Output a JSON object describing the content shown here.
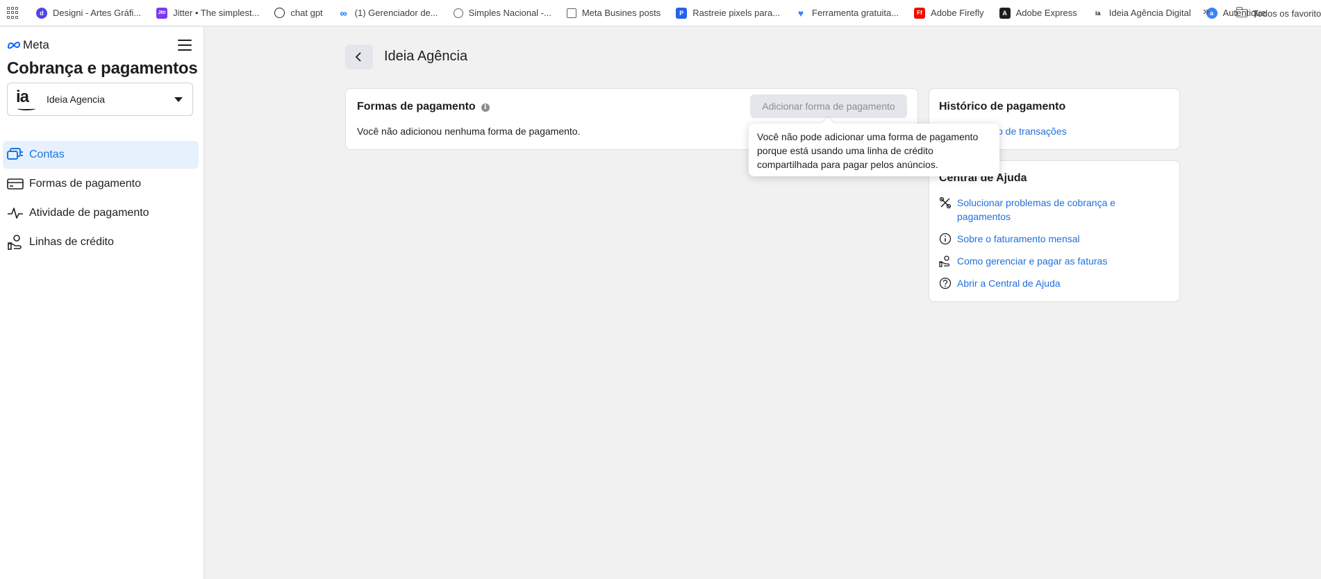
{
  "bookmarks": {
    "items": [
      {
        "label": "Designi - Artes Gráfi...",
        "icon": "designi-icon",
        "color": "#4f46e5"
      },
      {
        "label": "Jitter • The simplest...",
        "icon": "jitter-icon",
        "color": "#7c3aed"
      },
      {
        "label": "chat gpt",
        "icon": "openai-icon",
        "color": "#1c1e21"
      },
      {
        "label": "(1) Gerenciador de...",
        "icon": "meta-icon",
        "color": "#0866ff"
      },
      {
        "label": "Simples Nacional -...",
        "icon": "globe-icon",
        "color": "#5f6368"
      },
      {
        "label": "Meta Busines posts",
        "icon": "page-icon",
        "color": "#5f6368"
      },
      {
        "label": "Rastreie pixels para...",
        "icon": "pixel-icon",
        "color": "#2563eb"
      },
      {
        "label": "Ferramenta gratuita...",
        "icon": "heart-icon",
        "color": "#3b82f6"
      },
      {
        "label": "Adobe Firefly",
        "icon": "firefly-icon",
        "color": "#eb1000"
      },
      {
        "label": "Adobe Express",
        "icon": "adobe-express-icon",
        "color": "#1c1e21"
      },
      {
        "label": "Ideia Agência Digital",
        "icon": "ideia-icon",
        "color": "#5f6368"
      },
      {
        "label": "Autentique",
        "icon": "autentique-icon",
        "color": "#3b82f6"
      }
    ],
    "more": "»",
    "folder_label": "Todos os favoritos"
  },
  "sidebar": {
    "brand": "Meta",
    "title": "Cobrança e pagamentos",
    "account": {
      "logo_text": "ia",
      "name": "Ideia Agencia"
    },
    "nav": [
      {
        "label": "Contas",
        "icon": "accounts-icon",
        "active": true
      },
      {
        "label": "Formas de pagamento",
        "icon": "credit-card-icon",
        "active": false
      },
      {
        "label": "Atividade de pagamento",
        "icon": "activity-icon",
        "active": false
      },
      {
        "label": "Linhas de crédito",
        "icon": "credit-line-icon",
        "active": false
      }
    ]
  },
  "main": {
    "title": "Ideia Agência",
    "payment_methods": {
      "title": "Formas de pagamento",
      "add_button": "Adicionar forma de pagamento",
      "empty_text": "Você não adicionou nenhuma forma de pagamento."
    },
    "tooltip": "Você não pode adicionar uma forma de pagamento porque está usando uma linha de crédito compartilhada para pagar pelos anúncios.",
    "history": {
      "title": "Histórico de pagamento",
      "link": "co de transações"
    },
    "help": {
      "title": "Central de Ajuda",
      "links": [
        {
          "label": "Solucionar problemas de cobrança e pagamentos",
          "icon": "tools-icon"
        },
        {
          "label": "Sobre o faturamento mensal",
          "icon": "info-icon"
        },
        {
          "label": "Como gerenciar e pagar as faturas",
          "icon": "hand-money-icon"
        },
        {
          "label": "Abrir a Central de Ajuda",
          "icon": "question-icon"
        }
      ]
    }
  },
  "colors": {
    "accent": "#1b74e4",
    "link": "#216fdb",
    "active_bg": "#e7f0fd",
    "page_bg": "#f1f1f1"
  }
}
